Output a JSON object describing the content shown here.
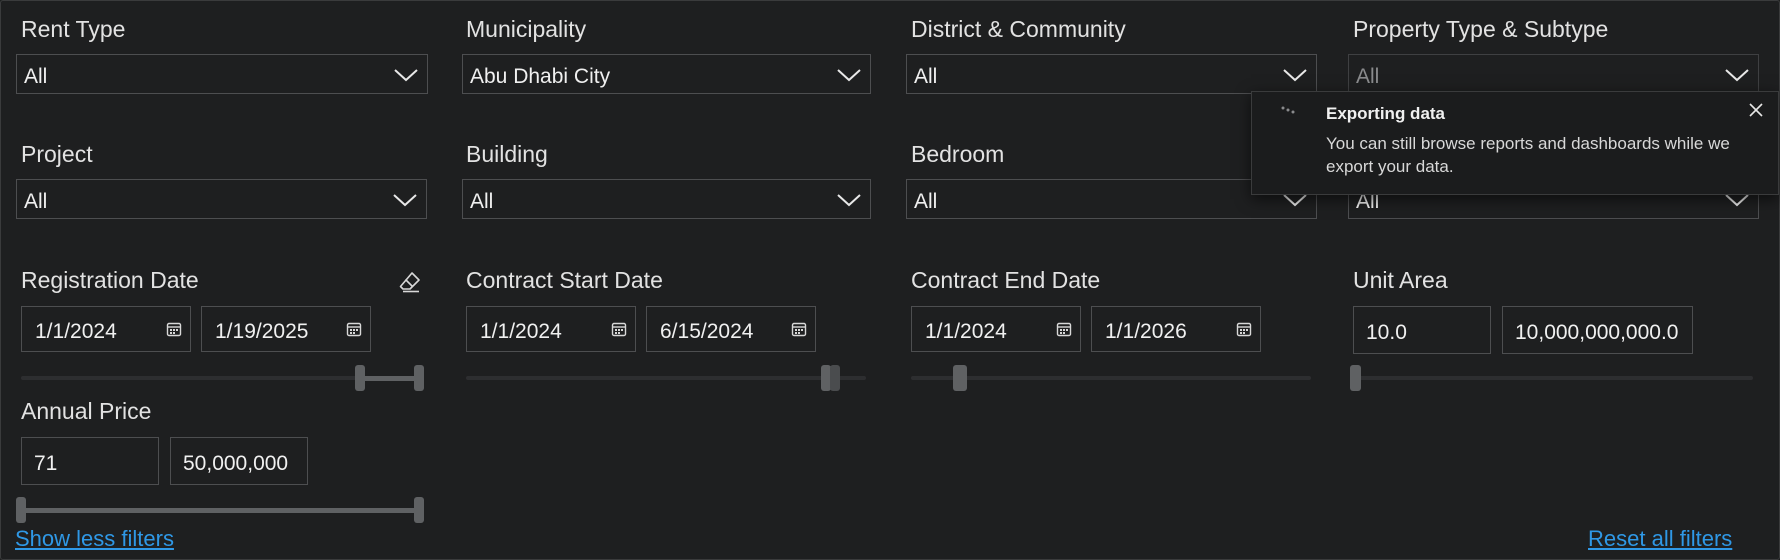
{
  "filters": {
    "rent_type": {
      "label": "Rent Type",
      "value": "All"
    },
    "municipality": {
      "label": "Municipality",
      "value": "Abu Dhabi City"
    },
    "district": {
      "label": "District & Community",
      "value": "All"
    },
    "property_type": {
      "label": "Property Type & Subtype",
      "value": "All"
    },
    "project": {
      "label": "Project",
      "value": "All"
    },
    "building": {
      "label": "Building",
      "value": "All"
    },
    "bedroom": {
      "label": "Bedroom",
      "value": "All"
    },
    "hidden_filter": {
      "value": "All"
    }
  },
  "ranges": {
    "registration_date": {
      "label": "Registration Date",
      "from": "1/1/2024",
      "to": "1/19/2025",
      "range_start_fraction": 0.86,
      "range_end_fraction": 0.99
    },
    "contract_start_date": {
      "label": "Contract Start Date",
      "from": "1/1/2024",
      "to": "6/15/2024",
      "range_start_fraction": 0.9,
      "range_end_fraction": 0.92
    },
    "contract_end_date": {
      "label": "Contract End Date",
      "from": "1/1/2024",
      "to": "1/1/2026",
      "range_start_fraction": 0.11,
      "range_end_fraction": 0.13
    },
    "unit_area": {
      "label": "Unit Area",
      "from": "10.0",
      "to": "10,000,000,000.0",
      "range_start_fraction": 0.0,
      "range_end_fraction": 0.0
    },
    "annual_price": {
      "label": "Annual Price",
      "from": "71",
      "to": "50,000,000",
      "range_start_fraction": 0.0,
      "range_end_fraction": 1.0
    }
  },
  "links": {
    "show_less": "Show less filters",
    "reset_all": "Reset all filters"
  },
  "toast": {
    "title": "Exporting data",
    "message": "You can still browse reports and dashboards while we export your data."
  },
  "colors": {
    "background": "#1e1f20",
    "link": "#2f98e6",
    "slider": "#5f6163"
  }
}
